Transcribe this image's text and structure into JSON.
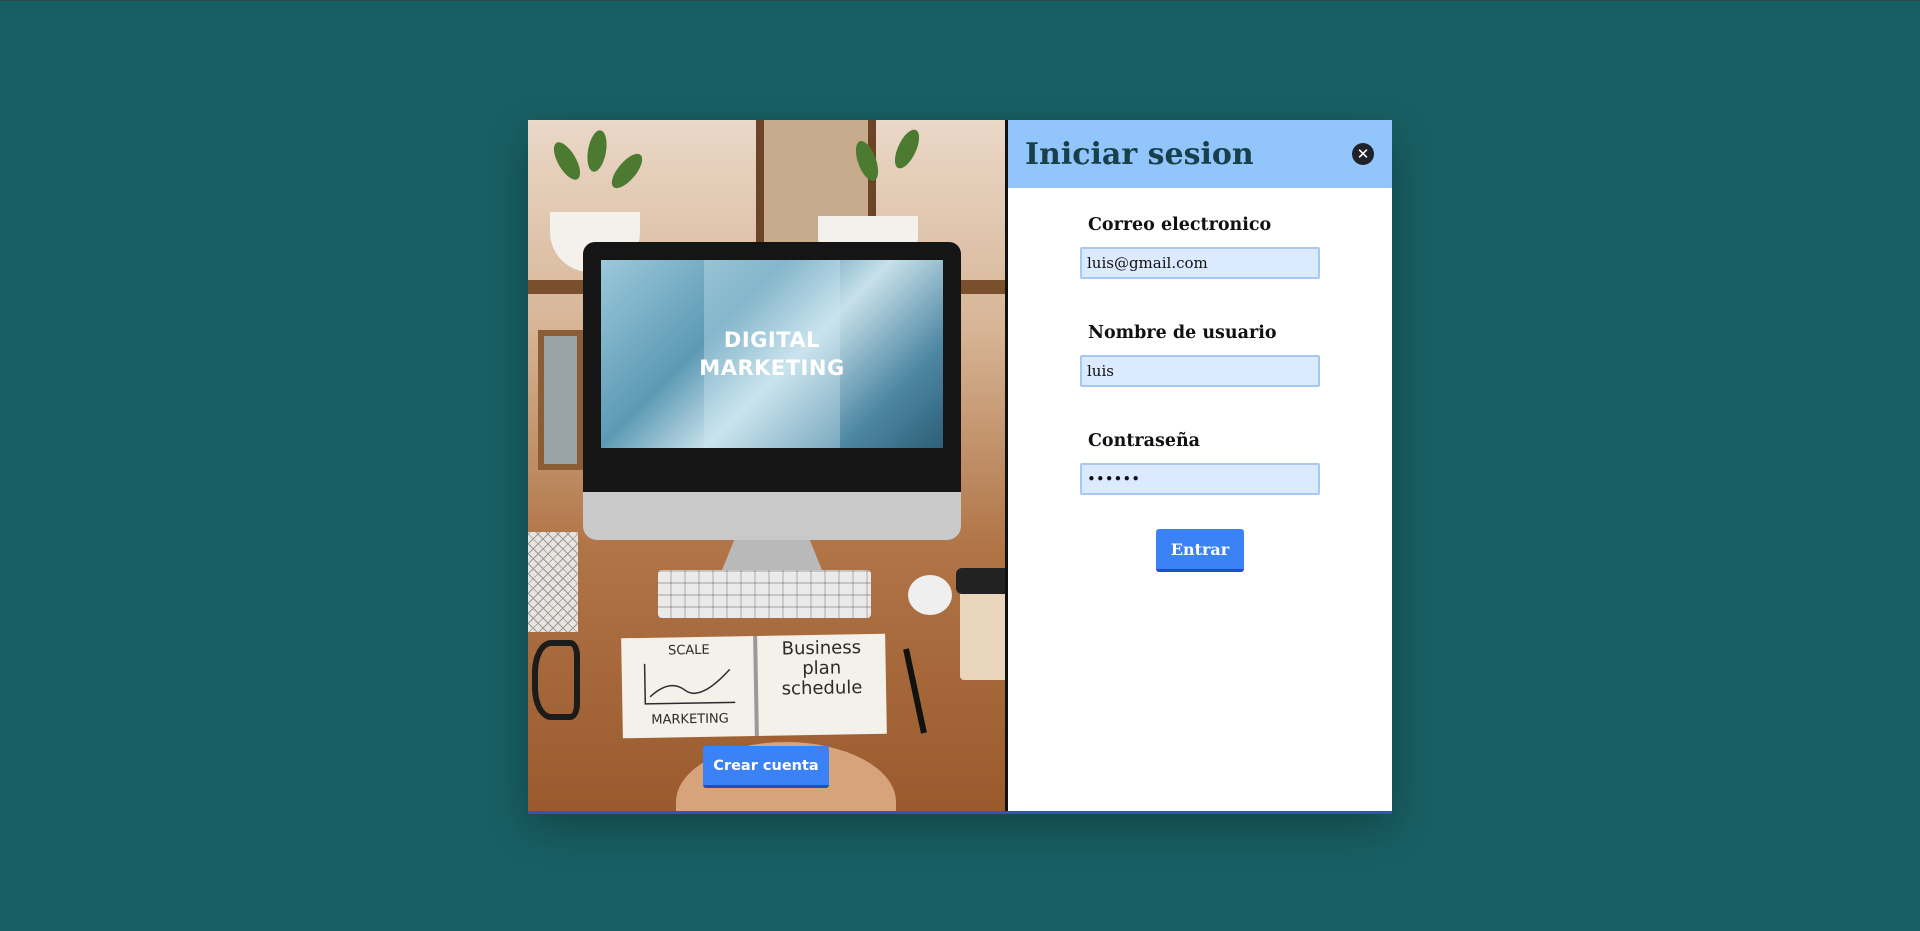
{
  "image_panel": {
    "screen_text_line1": "DIGITAL",
    "screen_text_line2": "MARKETING",
    "notebook_left_text": "SCALE",
    "notebook_left_bottom": "MARKETING",
    "notebook_right_line1": "Business",
    "notebook_right_line2": "plan",
    "notebook_right_line3": "schedule",
    "create_account_label": "Crear cuenta"
  },
  "login": {
    "title": "Iniciar sesion",
    "close_glyph": "✕",
    "email": {
      "label": "Correo electronico",
      "value": "luis@gmail.com"
    },
    "username": {
      "label": "Nombre de usuario",
      "value": "luis"
    },
    "password": {
      "label": "Contraseña",
      "value": "••••••"
    },
    "submit_label": "Entrar"
  },
  "colors": {
    "background": "#185f63",
    "header": "#93c5fd",
    "title": "#17404a",
    "button": "#3b82f6",
    "input_bg": "#dbeafe"
  }
}
